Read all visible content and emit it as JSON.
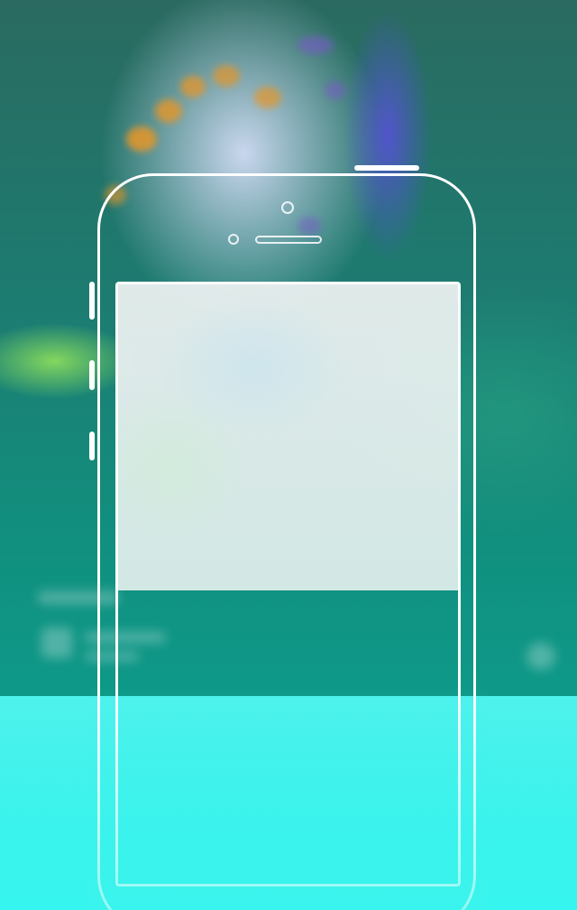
{
  "screen": {
    "name": "device-preview",
    "colors": {
      "accent_cyan": "#3af3ec",
      "teal_background": "#138a82",
      "outline": "#ffffff",
      "preview_panel": "#e4eeec"
    },
    "icons": {
      "camera": "camera-lens-icon",
      "sensor": "proximity-sensor-icon",
      "speaker": "earpiece-speaker-icon"
    }
  }
}
